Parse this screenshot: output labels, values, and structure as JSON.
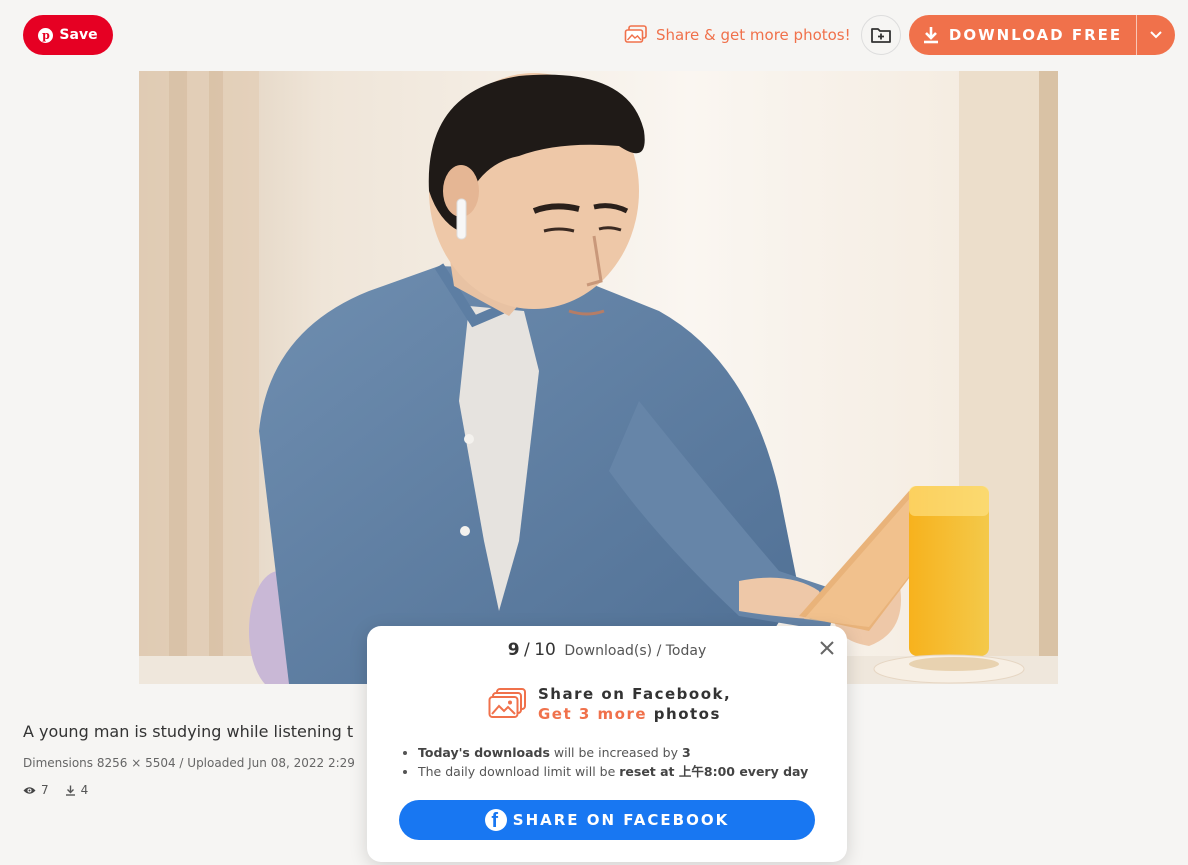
{
  "header": {
    "pinterest_save_label": "Save",
    "share_more_label": "Share & get more photos!",
    "download_label": "DOWNLOAD FREE"
  },
  "photo": {
    "icons": [
      "person-photo"
    ]
  },
  "info": {
    "title": "A young man is studying while listening t",
    "meta": "Dimensions 8256 × 5504 / Uploaded Jun 08, 2022 2:29",
    "views": "7",
    "downloads": "4"
  },
  "popup": {
    "count_current": "9",
    "count_sep": "/",
    "count_limit": "10",
    "count_label": "Download(s) / Today",
    "promo_line1": "Share on Facebook,",
    "promo_highlight": "Get 3 more",
    "promo_line2_tail": "photos",
    "bullet1_bold": "Today's downloads",
    "bullet1_mid": " will be increased by ",
    "bullet1_num": "3",
    "bullet2_pre": "The daily download limit will be ",
    "bullet2_bold": "reset at 上午8:00 every day",
    "fb_button_label": "SHARE ON FACEBOOK"
  },
  "colors": {
    "accent": "#f0714b",
    "pinterest": "#e60023",
    "facebook": "#1877f2",
    "background": "#f6f5f3"
  }
}
